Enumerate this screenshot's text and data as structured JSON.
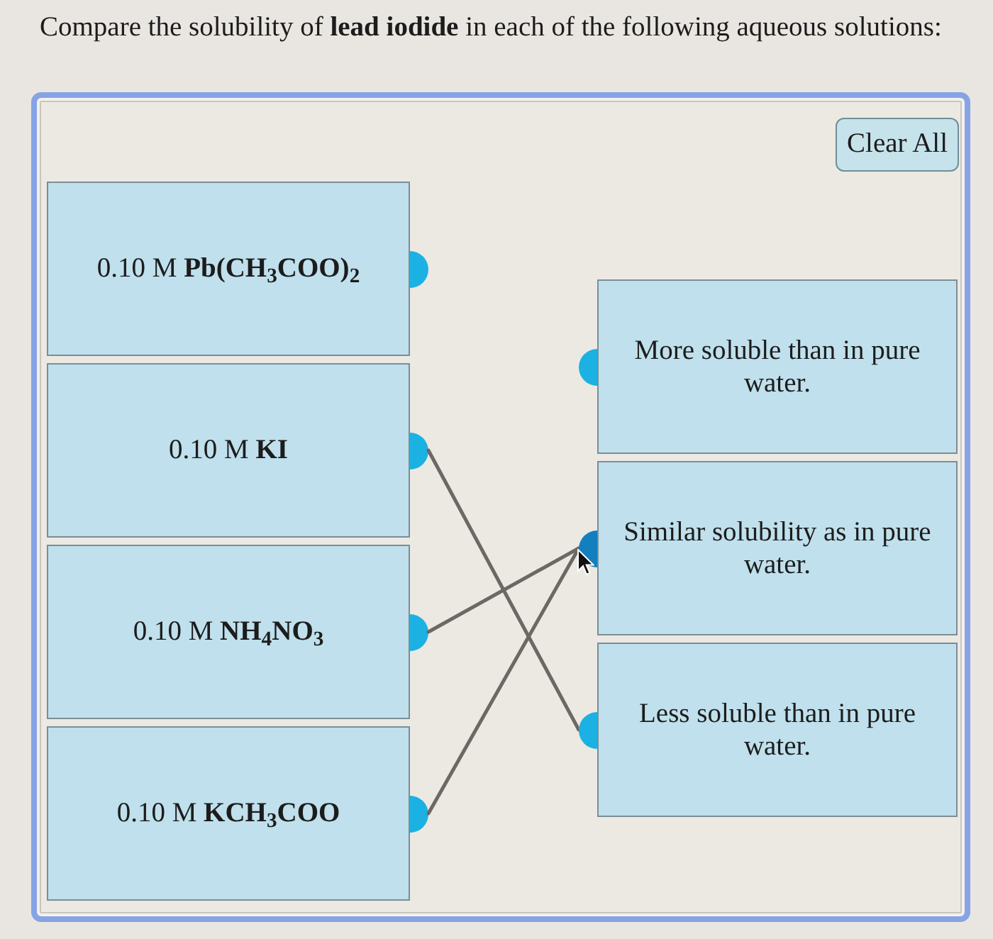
{
  "question": "Compare the solubility of **lead iodide** in each of the following aqueous solutions:",
  "clear_button": {
    "label": "Clear All"
  },
  "left_items": [
    {
      "text": "0.10 M **Pb(CH$_{3}$COO)$_{2}$**",
      "links": [
        false,
        false,
        false
      ]
    },
    {
      "text": "0.10 M **KI**",
      "links": [
        false,
        false,
        true
      ]
    },
    {
      "text": "0.10 M **NH$_{4}$NO$_{3}$**",
      "links": [
        false,
        true,
        false
      ]
    },
    {
      "text": "0.10 M **KCH$_{3}$COO**",
      "links": [
        false,
        true,
        false
      ]
    }
  ],
  "right_items": [
    {
      "text": "More soluble than in pure water.",
      "highlighted": false
    },
    {
      "text": "Similar solubility as in pure water.",
      "highlighted": true
    },
    {
      "text": "Less soluble than in pure water.",
      "highlighted": false
    }
  ]
}
